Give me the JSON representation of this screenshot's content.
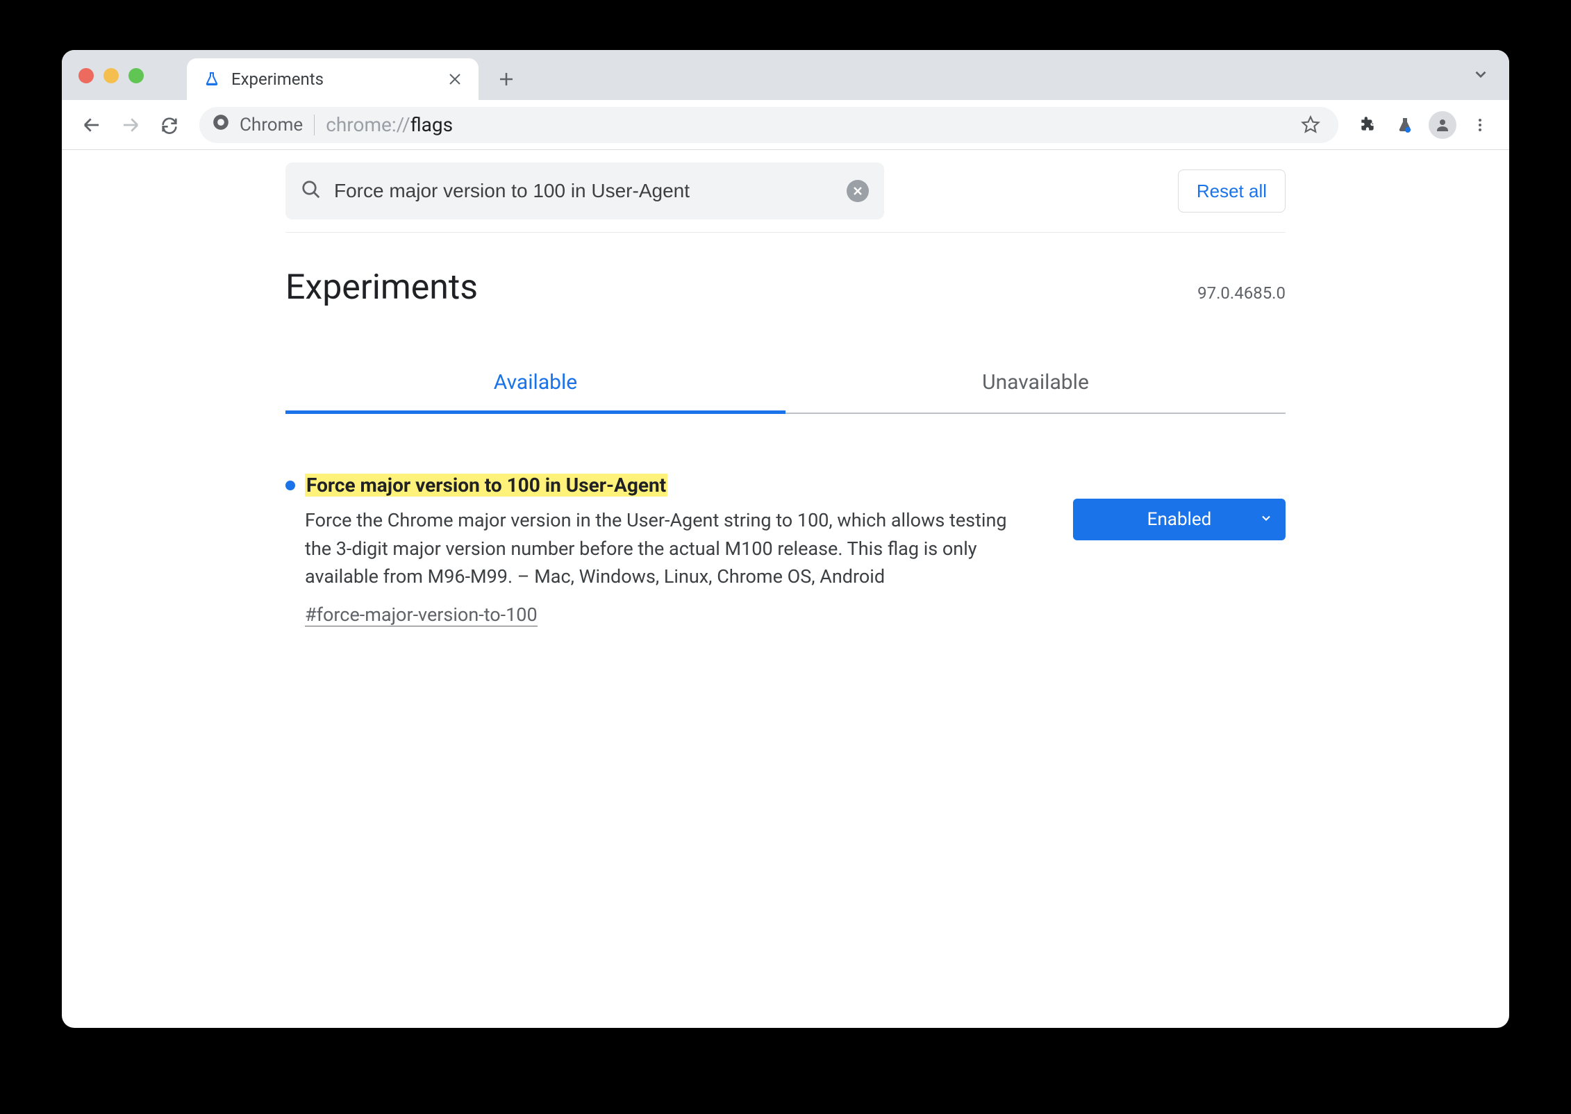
{
  "browser": {
    "tab_title": "Experiments",
    "address": {
      "chip": "Chrome",
      "url_prefix": "chrome://",
      "url_path": "flags"
    }
  },
  "search": {
    "value": "Force major version to 100 in User-Agent",
    "reset_label": "Reset all"
  },
  "page": {
    "title": "Experiments",
    "version": "97.0.4685.0",
    "tabs": {
      "available": "Available",
      "unavailable": "Unavailable"
    }
  },
  "flag": {
    "title": "Force major version to 100 in User-Agent",
    "description": "Force the Chrome major version in the User-Agent string to 100, which allows testing the 3-digit major version number before the actual M100 release. This flag is only available from M96-M99. – Mac, Windows, Linux, Chrome OS, Android",
    "anchor": "#force-major-version-to-100",
    "select_value": "Enabled"
  }
}
